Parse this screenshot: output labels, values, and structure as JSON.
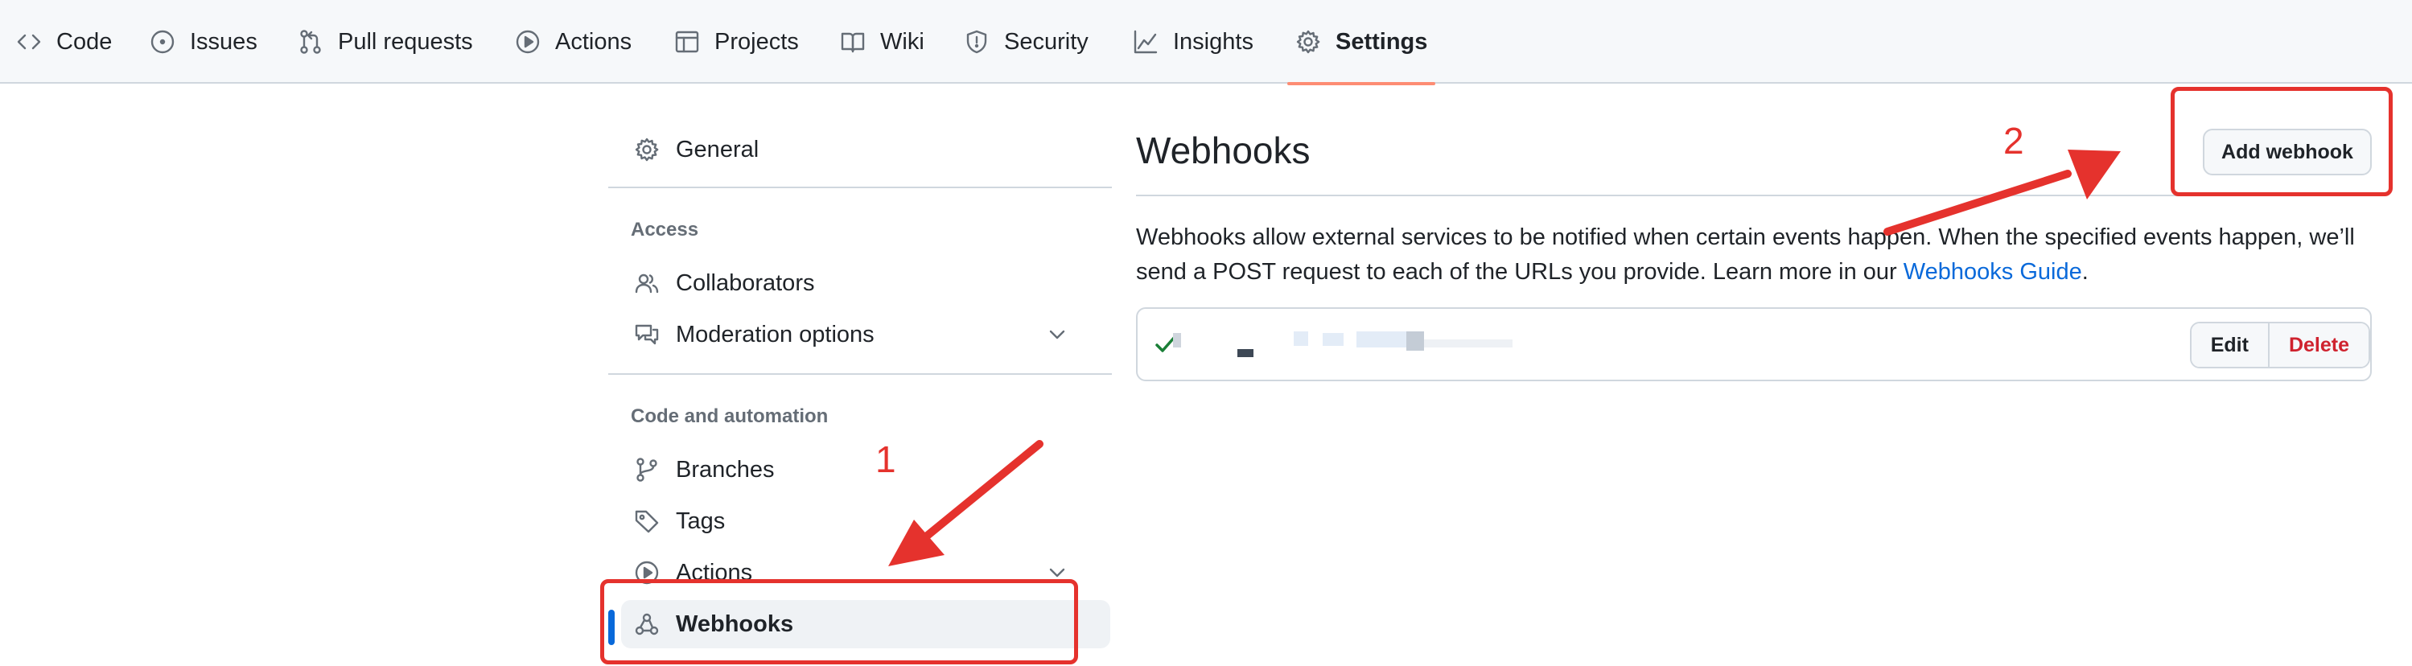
{
  "topnav": {
    "tabs": [
      {
        "label": "Code",
        "icon": "code-icon"
      },
      {
        "label": "Issues",
        "icon": "issue-opened-icon"
      },
      {
        "label": "Pull requests",
        "icon": "git-pull-request-icon"
      },
      {
        "label": "Actions",
        "icon": "play-icon"
      },
      {
        "label": "Projects",
        "icon": "table-icon"
      },
      {
        "label": "Wiki",
        "icon": "book-icon"
      },
      {
        "label": "Security",
        "icon": "shield-icon"
      },
      {
        "label": "Insights",
        "icon": "graph-icon"
      },
      {
        "label": "Settings",
        "icon": "gear-icon",
        "active": true
      }
    ]
  },
  "sidebar": {
    "general": "General",
    "access_heading": "Access",
    "collaborators": "Collaborators",
    "moderation": "Moderation options",
    "automation_heading": "Code and automation",
    "branches": "Branches",
    "tags": "Tags",
    "actions": "Actions",
    "webhooks": "Webhooks"
  },
  "main": {
    "title": "Webhooks",
    "add_button": "Add webhook",
    "description": "Webhooks allow external services to be notified when certain events happen. When the specified events happen, we’ll send a POST request to each of the URLs you provide. Learn more in our ",
    "guide_link": "Webhooks Guide",
    "description_end": ".",
    "hook": {
      "status_icon": "check-icon",
      "edit_label": "Edit",
      "delete_label": "Delete"
    }
  },
  "annotations": {
    "step1": "1",
    "step2": "2",
    "color": "#e5322d"
  },
  "colors": {
    "accent": "#0969da",
    "danger": "#cf222e",
    "tab_underline": "#fd8c73"
  }
}
